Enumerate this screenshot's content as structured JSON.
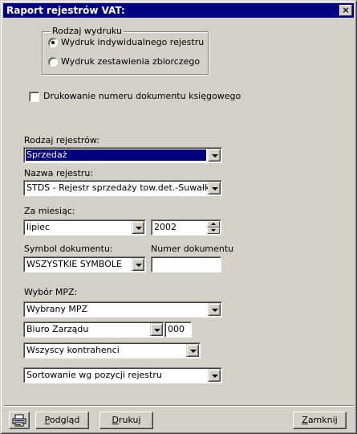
{
  "window": {
    "title": "Raport rejestrów VAT:",
    "close_glyph": "×"
  },
  "print_type": {
    "label": "Rodzaj wydruku",
    "options": [
      {
        "label": "Wydruk indywidualnego rejestru",
        "selected": true
      },
      {
        "label": "Wydruk zestawienia zbiorczego",
        "selected": false
      }
    ]
  },
  "print_doc_number": {
    "label": "Drukowanie numeru dokumentu księgowego",
    "checked": false
  },
  "register_type": {
    "label": "Rodzaj rejestrów:",
    "value": "Sprzedaż"
  },
  "register_name": {
    "label": "Nazwa rejestru:",
    "value": "STDS - Rejestr sprzedaży tow.det.-Suwałki"
  },
  "month": {
    "label": "Za miesiąc:",
    "value": "lipiec",
    "year": "2002"
  },
  "doc_symbol": {
    "label": "Symbol dokumentu:",
    "value": "WSZYSTKIE SYMBOLE"
  },
  "doc_number": {
    "label": "Numer dokumentu",
    "value": ""
  },
  "mpz": {
    "label": "Wybór MPZ:",
    "mode": "Wybrany MPZ",
    "unit": "Biuro Zarządu",
    "unit_code": "000",
    "contractors": "Wszyscy kontrahenci",
    "sorting": "Sortowanie wg pozycji rejestru"
  },
  "footer": {
    "printer_icon": "printer-icon",
    "preview_label_u": "P",
    "preview_label_rest": "odgląd",
    "print_label_u": "D",
    "print_label_rest": "rukuj",
    "close_label_u": "Z",
    "close_label_rest": "amknij"
  },
  "colors": {
    "titlebar": "#000080",
    "face": "#d4d0c8",
    "selection": "#000080"
  }
}
